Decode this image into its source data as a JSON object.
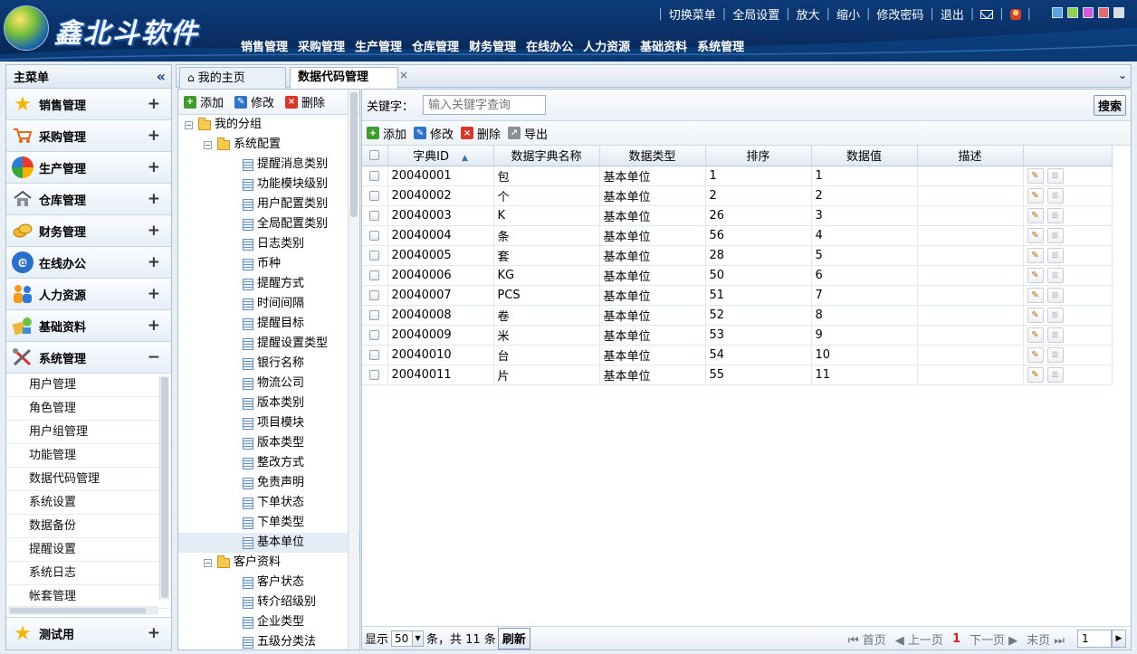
{
  "header": {
    "logo_text": "鑫北斗软件",
    "top_links": [
      "切换菜单",
      "全局设置",
      "放大",
      "缩小",
      "修改密码",
      "退出"
    ],
    "main_nav": [
      "销售管理",
      "采购管理",
      "生产管理",
      "仓库管理",
      "财务管理",
      "在线办公",
      "人力资源",
      "基础资料",
      "系统管理"
    ],
    "skin_colors": [
      "#5aa0e6",
      "#8fd14f",
      "#d25bd6",
      "#e06a6a",
      "#d8dde3"
    ]
  },
  "sidebar": {
    "title": "主菜单",
    "collapse_glyph": "«",
    "groups": [
      {
        "label": "销售管理",
        "toggle": "+",
        "icon": "star-icon"
      },
      {
        "label": "采购管理",
        "toggle": "+",
        "icon": "cart-icon"
      },
      {
        "label": "生产管理",
        "toggle": "+",
        "icon": "production-icon"
      },
      {
        "label": "仓库管理",
        "toggle": "+",
        "icon": "warehouse-icon"
      },
      {
        "label": "财务管理",
        "toggle": "+",
        "icon": "coins-icon"
      },
      {
        "label": "在线办公",
        "toggle": "+",
        "icon": "at-icon"
      },
      {
        "label": "人力资源",
        "toggle": "+",
        "icon": "people-icon"
      },
      {
        "label": "基础资料",
        "toggle": "+",
        "icon": "basics-icon"
      },
      {
        "label": "系统管理",
        "toggle": "−",
        "icon": "tools-icon"
      }
    ],
    "system_items": [
      "用户管理",
      "角色管理",
      "用户组管理",
      "功能管理",
      "数据代码管理",
      "系统设置",
      "数据备份",
      "提醒设置",
      "系统日志",
      "帐套管理"
    ],
    "last_group": {
      "label": "测试用",
      "toggle": "+",
      "icon": "star-icon"
    }
  },
  "tabs": [
    {
      "label": "我的主页",
      "icon": "home-icon"
    },
    {
      "label": "数据代码管理",
      "close": "×"
    }
  ],
  "tree_toolbar": {
    "add": "添加",
    "edit": "修改",
    "delete": "删除"
  },
  "tree": {
    "root": "我的分组",
    "group1": "系统配置",
    "group1_items": [
      "提醒消息类别",
      "功能模块级别",
      "用户配置类别",
      "全局配置类别",
      "日志类别",
      "币种",
      "提醒方式",
      "时间间隔",
      "提醒目标",
      "提醒设置类型",
      "银行名称",
      "物流公司",
      "版本类别",
      "项目模块",
      "版本类型",
      "整改方式",
      "免责声明",
      "下单状态",
      "下单类型",
      "基本单位"
    ],
    "selected": "基本单位",
    "group2": "客户资料",
    "group2_items": [
      "客户状态",
      "转介绍级别",
      "企业类型",
      "五级分类法"
    ]
  },
  "search": {
    "label": "关键字：",
    "placeholder": "输入关键字查询",
    "button": "搜索"
  },
  "grid_toolbar": {
    "add": "添加",
    "edit": "修改",
    "delete": "删除",
    "export": "导出"
  },
  "grid": {
    "columns": [
      "字典ID",
      "数据字典名称",
      "数据类型",
      "排序",
      "数据值",
      "描述"
    ],
    "rows": [
      [
        "20040001",
        "包",
        "基本单位",
        "1",
        "1",
        ""
      ],
      [
        "20040002",
        "个",
        "基本单位",
        "2",
        "2",
        ""
      ],
      [
        "20040003",
        "K",
        "基本单位",
        "26",
        "3",
        ""
      ],
      [
        "20040004",
        "条",
        "基本单位",
        "56",
        "4",
        ""
      ],
      [
        "20040005",
        "套",
        "基本单位",
        "28",
        "5",
        ""
      ],
      [
        "20040006",
        "KG",
        "基本单位",
        "50",
        "6",
        ""
      ],
      [
        "20040007",
        "PCS",
        "基本单位",
        "51",
        "7",
        ""
      ],
      [
        "20040008",
        "卷",
        "基本单位",
        "52",
        "8",
        ""
      ],
      [
        "20040009",
        "米",
        "基本单位",
        "53",
        "9",
        ""
      ],
      [
        "20040010",
        "台",
        "基本单位",
        "54",
        "10",
        ""
      ],
      [
        "20040011",
        "片",
        "基本单位",
        "55",
        "11",
        ""
      ]
    ]
  },
  "pager": {
    "show_label": "显示",
    "page_size": "50",
    "count_text": "条，共 11 条",
    "refresh": "刷新",
    "first": "首页",
    "prev": "上一页",
    "current": "1",
    "next": "下一页",
    "last": "末页",
    "page_input": "1"
  }
}
